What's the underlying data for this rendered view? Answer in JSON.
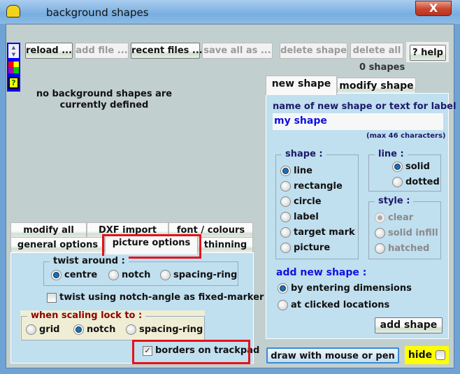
{
  "window": {
    "title": "background shapes",
    "close_label": "X"
  },
  "toolbar": {
    "reload": "reload ...",
    "add_file": "add file ...",
    "recent_files": "recent files ...",
    "save_all_as": "save all as ...",
    "delete_shape": "delete shape",
    "delete_all": "delete all",
    "help": "? help",
    "shape_count": "0 shapes"
  },
  "side_icons": {
    "help": "?"
  },
  "status_message": [
    "no background shapes are",
    "currently defined"
  ],
  "lower_tabs": {
    "row1": [
      "modify all",
      "DXF import",
      "font / colours"
    ],
    "row2": [
      "general options",
      "picture options",
      "thinning"
    ],
    "active": "picture options"
  },
  "picture_options": {
    "twist_around": {
      "legend": "twist around :",
      "options": [
        "centre",
        "notch",
        "spacing-ring"
      ],
      "selected": "centre"
    },
    "twist_checkbox": {
      "label": "twist using notch-angle as fixed-marker",
      "checked": false
    },
    "scaling_lock": {
      "legend": "when scaling lock to :",
      "options": [
        "grid",
        "notch",
        "spacing-ring"
      ],
      "selected": "notch"
    },
    "borders_checkbox": {
      "label": "borders on trackpad",
      "checked": true
    }
  },
  "right_tabs": {
    "items": [
      "new shape",
      "modify shape"
    ],
    "active": "new shape"
  },
  "new_shape": {
    "name_label": "name of new shape or text for label :",
    "name_value": "my shape",
    "max_hint": "(max 46 characters)",
    "shape": {
      "legend": "shape :",
      "options": [
        "line",
        "rectangle",
        "circle",
        "label",
        "target mark",
        "picture"
      ],
      "selected": "line"
    },
    "line": {
      "legend": "line :",
      "options": [
        "solid",
        "dotted"
      ],
      "selected": "solid"
    },
    "style": {
      "legend": "style :",
      "options": [
        "clear",
        "solid infill",
        "hatched"
      ],
      "selected": "clear",
      "disabled": true
    },
    "add_mode": {
      "heading": "add new shape :",
      "options": [
        "by entering dimensions",
        "at clicked locations"
      ],
      "selected": "by entering dimensions"
    },
    "add_button": "add shape"
  },
  "bottom": {
    "draw_button": "draw with mouse or pen",
    "hide_label": "hide",
    "hide_color": "#ffff00"
  }
}
